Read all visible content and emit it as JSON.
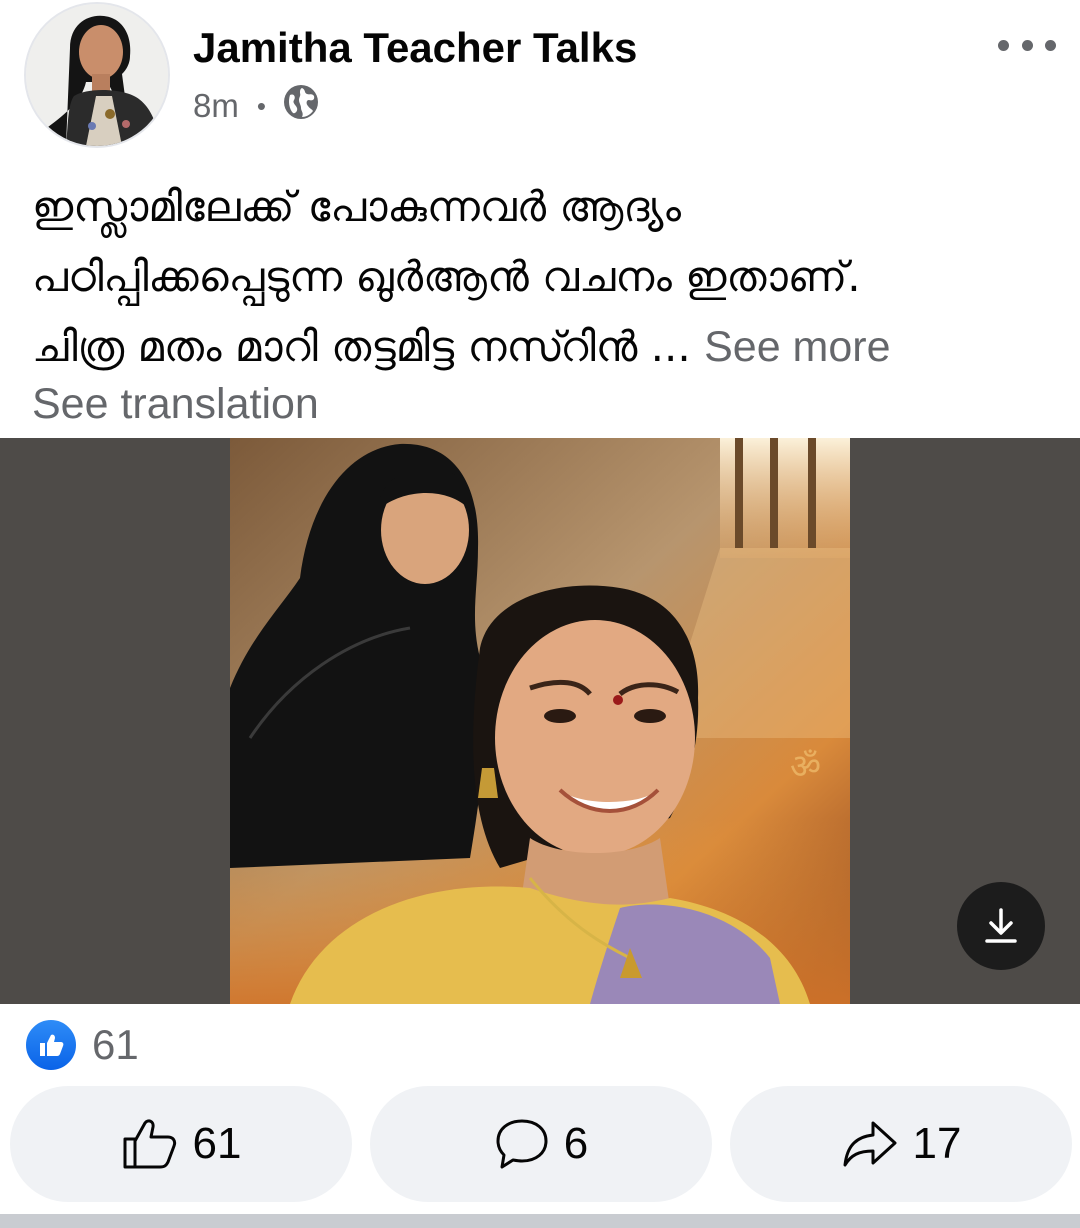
{
  "post": {
    "author": "Jamitha Teacher Talks",
    "time": "8m",
    "privacy_icon": "globe-icon",
    "text_lines": [
      "ഇസ്ലാമിലേക്ക് പോകുന്നവർ ആദ്യം",
      "പഠിപ്പിക്കപ്പെടുന്ന ഖുർആൻ വചനം ഇതാണ്.",
      "ചിത്ര മതം മാറി തട്ടമിട്ട നസ്റിൻ ..."
    ],
    "see_more": "See more",
    "see_translation": "See translation"
  },
  "reactions": {
    "summary_count": "61"
  },
  "actions": {
    "like_count": "61",
    "comment_count": "6",
    "share_count": "17"
  },
  "colors": {
    "accent": "#1877f2",
    "secondary_text": "#65676b",
    "button_bg": "#f0f2f5"
  }
}
